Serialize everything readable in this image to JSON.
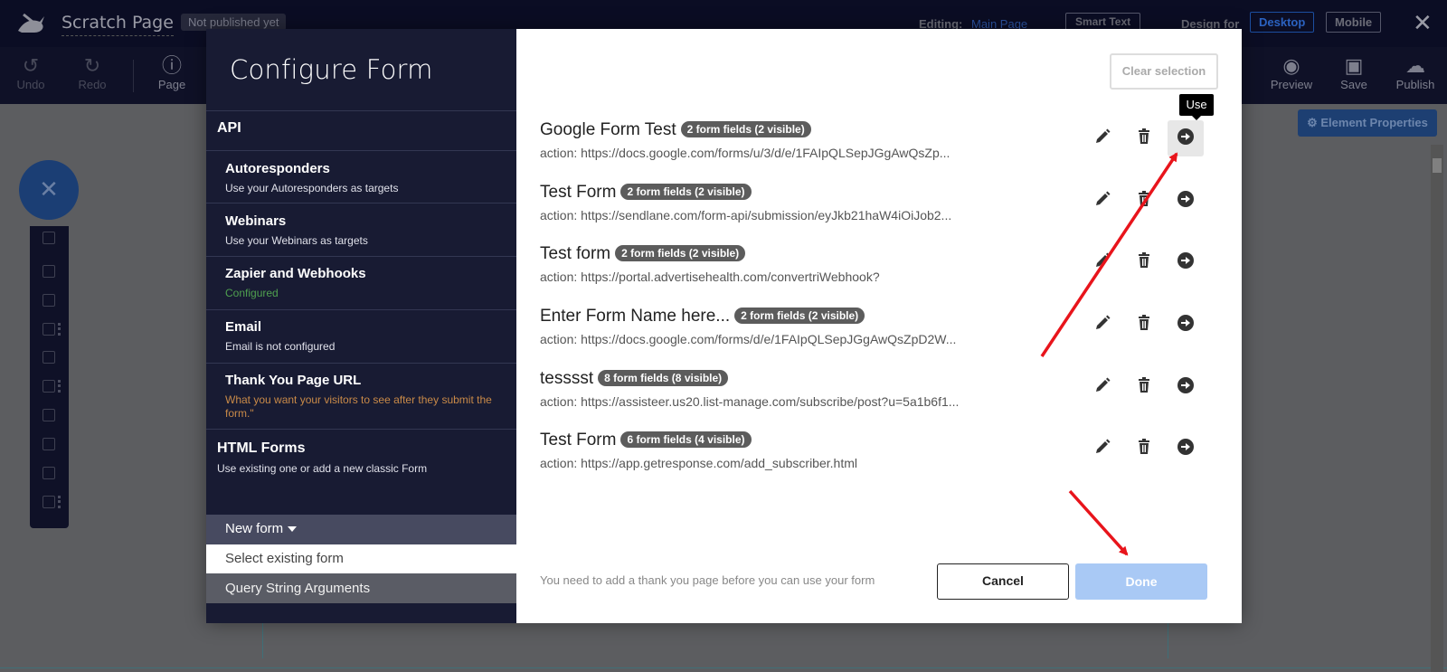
{
  "app": {
    "title": "Scratch Page",
    "publish_status": "Not published yet",
    "editing_label": "Editing:",
    "editing_page": "Main Page",
    "smart_text": "Smart Text",
    "design_for": "Design for",
    "desktop": "Desktop",
    "mobile": "Mobile",
    "close": "✕"
  },
  "toolbar": {
    "undo": "Undo",
    "redo": "Redo",
    "page": "Page",
    "preview": "Preview",
    "save": "Save",
    "publish": "Publish",
    "element_properties": "⚙ Element Properties"
  },
  "modal": {
    "title": "Configure Form",
    "sections": {
      "api": "API",
      "autoresponders": {
        "title": "Autoresponders",
        "sub": "Use your Autoresponders as targets"
      },
      "webinars": {
        "title": "Webinars",
        "sub": "Use your Webinars as targets"
      },
      "zapier": {
        "title": "Zapier and Webhooks",
        "sub": "Configured"
      },
      "email": {
        "title": "Email",
        "sub": "Email is not configured"
      },
      "thankyou": {
        "title": "Thank You Page URL",
        "sub": "What you want your visitors to see after they submit the form.\""
      },
      "html_forms": {
        "title": "HTML Forms",
        "sub": "Use existing one or add a new classic Form"
      }
    },
    "menu": {
      "new_form": "New form",
      "select_existing": "Select existing form",
      "query_string": "Query String Arguments"
    },
    "clear_selection": "Clear selection",
    "note": "You need to add a thank you page before you can use your form",
    "cancel": "Cancel",
    "done": "Done"
  },
  "forms": {
    "use_tooltip": "Use",
    "items": [
      {
        "name": "Google Form Test",
        "badge": "2 form fields (2 visible)",
        "action": "action: https://docs.google.com/forms/u/3/d/e/1FAIpQLSepJGgAwQsZp..."
      },
      {
        "name": "Test Form",
        "badge": "2 form fields (2 visible)",
        "action": "action: https://sendlane.com/form-api/submission/eyJkb21haW4iOiJob2..."
      },
      {
        "name": "Test form",
        "badge": "2 form fields (2 visible)",
        "action": "action: https://portal.advertisehealth.com/convertriWebhook?"
      },
      {
        "name": "Enter Form Name here...",
        "badge": "2 form fields (2 visible)",
        "action": "action: https://docs.google.com/forms/d/e/1FAIpQLSepJGgAwQsZpD2W..."
      },
      {
        "name": "tesssst",
        "badge": "8 form fields (8 visible)",
        "action": "action: https://assisteer.us20.list-manage.com/subscribe/post?u=5a1b6f1..."
      },
      {
        "name": "Test Form",
        "badge": "6 form fields (4 visible)",
        "action": "action: https://app.getresponse.com/add_subscriber.html"
      }
    ]
  },
  "colors": {
    "modal_sidebar": "#181b33",
    "done_disabled": "#a9c9f5",
    "annotation_arrow": "#e8141b"
  },
  "icons": [
    "pencil-icon",
    "trash-icon",
    "arrow-circle-right-icon",
    "undo-icon",
    "redo-icon",
    "info-icon",
    "eye-icon",
    "floppy-icon",
    "cloud-upload-icon",
    "close-icon",
    "rabbit-logo"
  ]
}
